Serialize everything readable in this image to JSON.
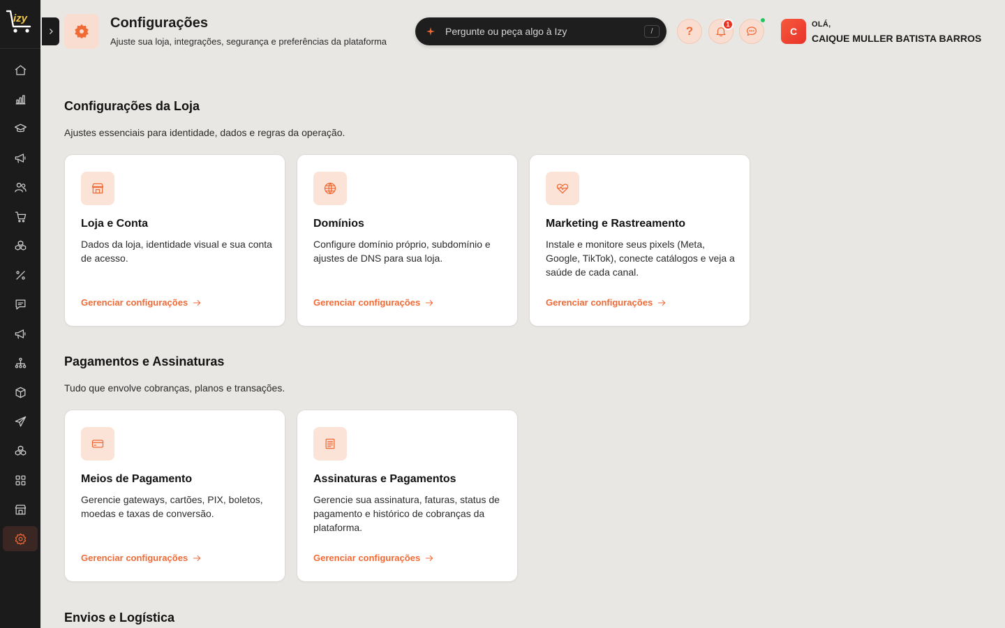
{
  "app": {
    "logo_text": "izy"
  },
  "header": {
    "title": "Configurações",
    "subtitle": "Ajuste sua loja, integrações, segurança e preferências da plataforma",
    "ask_placeholder": "Pergunte ou peça algo à Izy",
    "ask_shortcut": "/",
    "help_label": "?",
    "notifications_count": "1",
    "user": {
      "greeting": "OLÁ,",
      "name": "CAIQUE MULLER BATISTA BARROS",
      "initial": "C"
    }
  },
  "sidebar": {
    "items": [
      {
        "icon": "home-icon"
      },
      {
        "icon": "bar-chart-icon"
      },
      {
        "icon": "graduation-cap-icon"
      },
      {
        "icon": "megaphone-icon"
      },
      {
        "icon": "users-icon"
      },
      {
        "icon": "cart-icon"
      },
      {
        "icon": "boxes-icon"
      },
      {
        "icon": "percent-icon"
      },
      {
        "icon": "message-icon"
      },
      {
        "icon": "megaphone-icon"
      },
      {
        "icon": "network-icon"
      },
      {
        "icon": "package-icon"
      },
      {
        "icon": "send-icon"
      },
      {
        "icon": "boxes-icon"
      },
      {
        "icon": "apps-grid-icon"
      },
      {
        "icon": "store-icon"
      },
      {
        "icon": "settings-icon",
        "active": true
      }
    ]
  },
  "sections": [
    {
      "title": "Configurações da Loja",
      "description": "Ajustes essenciais para identidade, dados e regras da operação.",
      "cards": [
        {
          "icon": "store-icon",
          "title": "Loja e Conta",
          "description": "Dados da loja, identidade visual e sua conta de acesso.",
          "link": "Gerenciar configurações"
        },
        {
          "icon": "globe-icon",
          "title": "Domínios",
          "description": "Configure domínio próprio, subdomínio e ajustes de DNS para sua loja.",
          "link": "Gerenciar configurações"
        },
        {
          "icon": "heart-pulse-icon",
          "title": "Marketing e Rastreamento",
          "description": "Instale e monitore seus pixels (Meta, Google, TikTok), conecte catálogos e veja a saúde de cada canal.",
          "link": "Gerenciar configurações"
        }
      ]
    },
    {
      "title": "Pagamentos e Assinaturas",
      "description": "Tudo que envolve cobranças, planos e transações.",
      "cards": [
        {
          "icon": "credit-card-icon",
          "title": "Meios de Pagamento",
          "description": "Gerencie gateways, cartões, PIX, boletos, moedas e taxas de conversão.",
          "link": "Gerenciar configurações"
        },
        {
          "icon": "receipt-icon",
          "title": "Assinaturas e Pagamentos",
          "description": "Gerencie sua assinatura, faturas, status de pagamento e histórico de cobranças da plataforma.",
          "link": "Gerenciar configurações"
        }
      ]
    },
    {
      "title": "Envios e Logística"
    }
  ],
  "colors": {
    "accent": "#f06a35",
    "sidebar_bg": "#1b1b1b",
    "page_bg": "#e9e7e4"
  }
}
